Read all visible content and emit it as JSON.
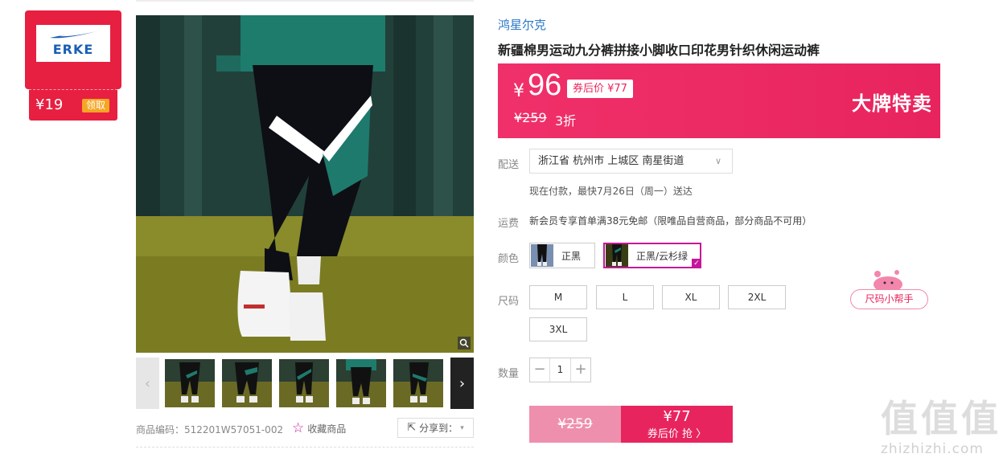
{
  "brand_badge": {
    "logo_text": "ERKE",
    "coupon_price": "¥19",
    "coupon_button": "领取"
  },
  "gallery": {
    "sku_label": "商品编码：512201W57051-002",
    "favorite_label": "收藏商品",
    "share_label": "分享到：",
    "thumbnail_count": 6
  },
  "product": {
    "brand": "鸿星尔克",
    "title": "新疆棉男运动九分裤拼接小脚收口印花男针织休闲运动裤"
  },
  "price_banner": {
    "currency": "¥",
    "price": "96",
    "after_coupon": "券后价 ¥77",
    "original_price": "¥259",
    "discount": "3折",
    "promo": "大牌特卖",
    "accent_color": "#e8245e"
  },
  "delivery": {
    "label": "配送",
    "address": "浙江省 杭州市 上城区 南星街道",
    "note": "现在付款，最快7月26日（周一）送达"
  },
  "shipping": {
    "label": "运费",
    "text": "新会员专享首单满38元免邮（限唯品自营商品，部分商品不可用）"
  },
  "color": {
    "label": "颜色",
    "options": [
      {
        "name": "正黑",
        "selected": false
      },
      {
        "name": "正黑/云杉绿",
        "selected": true
      }
    ]
  },
  "size": {
    "label": "尺码",
    "options": [
      "M",
      "L",
      "XL",
      "2XL",
      "3XL"
    ],
    "helper": "尺码小帮手"
  },
  "quantity": {
    "label": "数量",
    "minus": "−",
    "plus": "+",
    "value": "1"
  },
  "buy": {
    "original": "¥259",
    "coupon_price": "¥77",
    "coupon_label": "券后价 抢 〉"
  },
  "watermark": {
    "mark": "值值值",
    "url": "zhizhizhi.com"
  }
}
